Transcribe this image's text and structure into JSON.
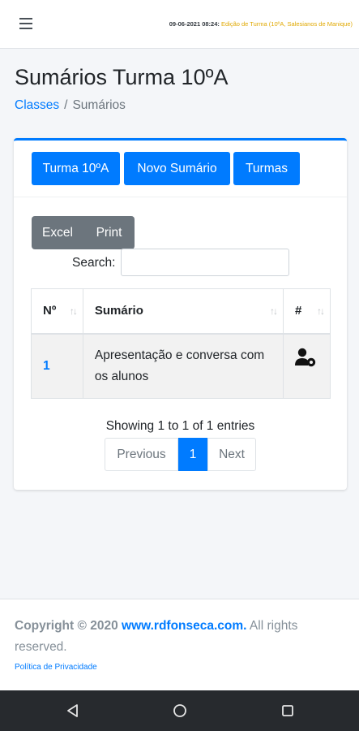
{
  "topbar": {
    "datetime": "09-06-2021 08:24:",
    "edition": "Edição de Turma (10ºA, Salesianos de Manique)"
  },
  "page": {
    "title": "Sumários Turma 10ºA",
    "breadcrumb": {
      "link": "Classes",
      "separator": "/",
      "current": "Sumários"
    }
  },
  "actions": {
    "turma": "Turma 10ºA",
    "novo_sumario": "Novo Sumário",
    "turmas": "Turmas"
  },
  "export": {
    "excel": "Excel",
    "print": "Print"
  },
  "search": {
    "label": "Search:",
    "value": ""
  },
  "table": {
    "headers": {
      "num": "Nº",
      "sumario": "Sumário",
      "actions": "#"
    },
    "rows": [
      {
        "num": "1",
        "sumario": "Apresentação e conversa com os alunos",
        "action_icon": "user-cog-icon"
      }
    ]
  },
  "pagination": {
    "info": "Showing 1 to 1 of 1 entries",
    "previous": "Previous",
    "current": "1",
    "next": "Next"
  },
  "footer": {
    "copyright_prefix": "Copyright © 2020 ",
    "site": "www.rdfonseca.com.",
    "rights": " All rights reserved.",
    "privacy": "Política de Privacidade"
  },
  "colors": {
    "primary": "#007bff",
    "secondary": "#6c757d",
    "warning_text": "#e0a800",
    "nav_bar": "#272a2e"
  },
  "icons": {
    "menu": "hamburger-menu-icon",
    "sort": "sort-arrows-icon",
    "row_action": "user-cog-icon",
    "nav_back": "back-triangle-icon",
    "nav_home": "home-circle-icon",
    "nav_recents": "recents-square-icon"
  }
}
